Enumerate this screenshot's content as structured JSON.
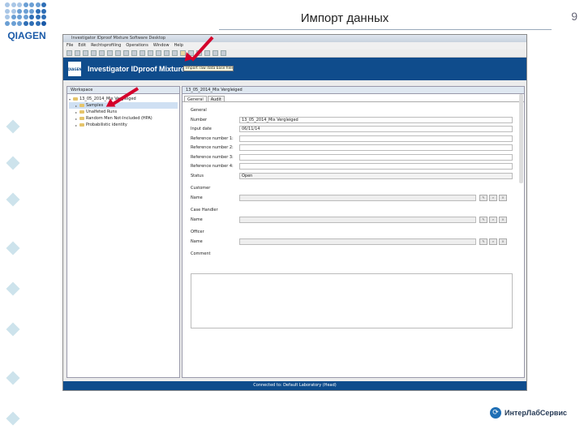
{
  "slide": {
    "title": "Импорт данных",
    "page_number": "9",
    "logo_text": "QIAGEN",
    "footer_brand": "ИнтерЛабСервис"
  },
  "window": {
    "title": "Investigator IDproof Mixture Software Desktop",
    "menu": [
      "File",
      "Edit",
      "Rechtsprofiling",
      "Operations",
      "Window",
      "Help"
    ],
    "banner_logo": "QIAGEN",
    "banner_title": "Investigator IDproof Mixture",
    "tooltip": "Import raw data base files",
    "status": "Connected to: Default Laboratory (Head)"
  },
  "workspace": {
    "tab_label": "Workspace",
    "items": [
      {
        "label": "13_05_2014_Mix Vergleiged",
        "level": 0
      },
      {
        "label": "Samples",
        "level": 1
      },
      {
        "label": "Unalfeted Runs",
        "level": 1
      },
      {
        "label": "Random Men Not-Included (HPA)",
        "level": 1
      },
      {
        "label": "Probabilistic identity",
        "level": 1
      }
    ]
  },
  "editor": {
    "tab_label": "13_05_2014_Mix Vergleiged",
    "sub_tabs": [
      "General",
      "Audit"
    ],
    "section_general": "General",
    "fields": [
      {
        "label": "Number",
        "value": "13_05_2014_Mix Vergleiged"
      },
      {
        "label": "Input date",
        "value": "06/11/14"
      },
      {
        "label": "Reference number 1:",
        "value": ""
      },
      {
        "label": "Reference number 2:",
        "value": ""
      },
      {
        "label": "Reference number 3:",
        "value": ""
      },
      {
        "label": "Reference number 4:",
        "value": ""
      },
      {
        "label": "Status",
        "value": "Open"
      }
    ],
    "customer_group": "Customer",
    "customer_label": "Name",
    "case_handler_group": "Case Handler",
    "case_handler_label": "Name",
    "officer_group": "Officer",
    "officer_label": "Name",
    "comment_group": "Comment"
  }
}
